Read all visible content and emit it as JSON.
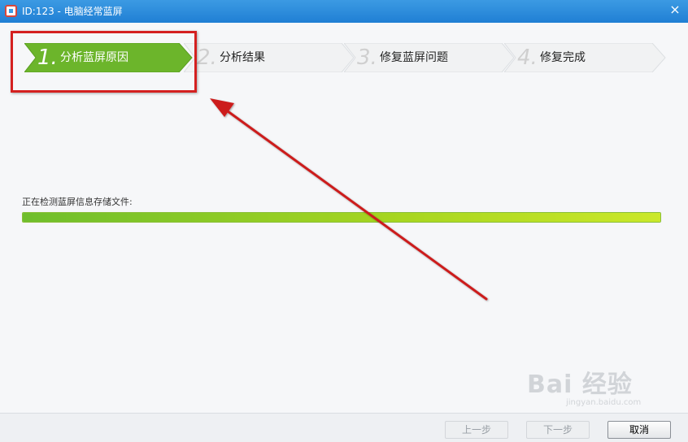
{
  "window": {
    "title": "ID:123 - 电脑经常蓝屏",
    "close_glyph": "×"
  },
  "steps": [
    {
      "num": "1.",
      "label": "分析蓝屏原因",
      "active": true
    },
    {
      "num": "2.",
      "label": "分析结果",
      "active": false
    },
    {
      "num": "3.",
      "label": "修复蓝屏问题",
      "active": false
    },
    {
      "num": "4.",
      "label": "修复完成",
      "active": false
    }
  ],
  "status": {
    "text": "正在检测蓝屏信息存储文件:",
    "progress": 1.0
  },
  "footer": {
    "prev": "上一步",
    "next": "下一步",
    "cancel": "取消"
  },
  "watermark": {
    "brand": "Bai 经验",
    "url": "jingyan.baidu.com"
  },
  "colors": {
    "titlebar": "#2a8ae0",
    "active_step": "#6cb52b",
    "annotation": "#d42020"
  },
  "icons": {
    "app": "lifebuoy-icon",
    "close": "close-icon",
    "annotation_arrow": "red-arrow-icon"
  }
}
